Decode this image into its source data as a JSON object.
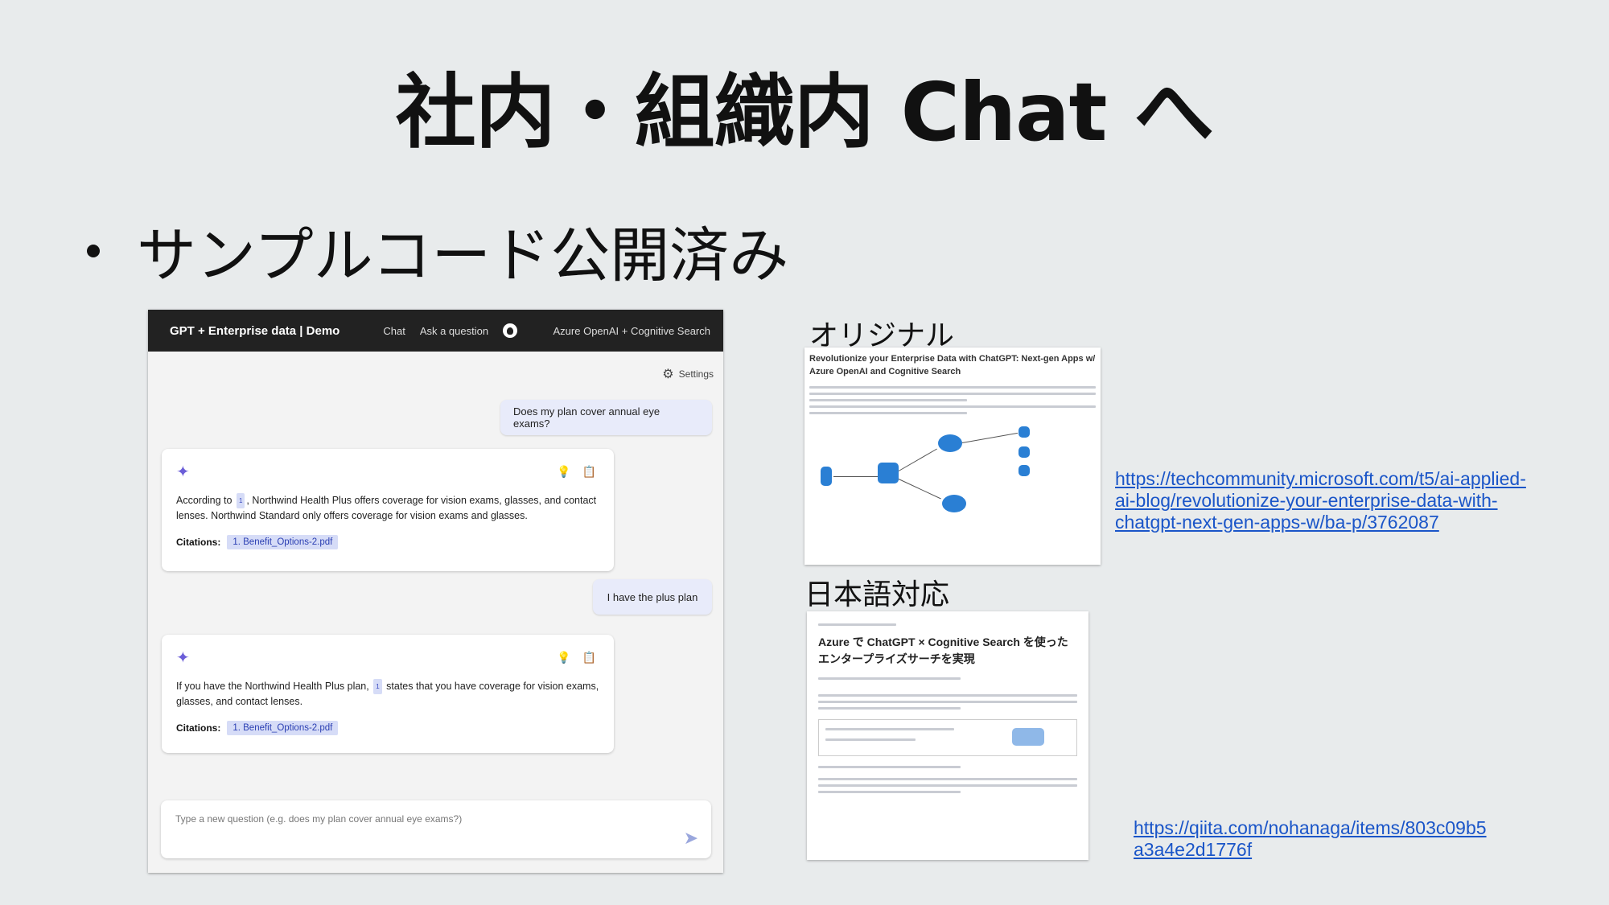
{
  "slide": {
    "title": "社内・組織内 Chat へ",
    "bullet": "サンプルコード公開済み"
  },
  "demo": {
    "brand": "GPT + Enterprise data | Demo",
    "nav": [
      "Chat",
      "Ask a question"
    ],
    "service": "Azure OpenAI + Cognitive Search",
    "settings_label": "Settings",
    "messages": [
      {
        "role": "user",
        "text": "Does my plan cover annual eye exams?"
      },
      {
        "role": "assistant",
        "text_before": "According to",
        "citation_marker": "1",
        "text_after": ", Northwind Health Plus offers coverage for vision exams, glasses, and contact lenses. Northwind Standard only offers coverage for vision exams and glasses.",
        "citations_label": "Citations:",
        "citation": "1. Benefit_Options-2.pdf"
      },
      {
        "role": "user",
        "text": "I have the plus plan"
      },
      {
        "role": "assistant",
        "text_before": "If you have the Northwind Health Plus plan,",
        "citation_marker": "1",
        "text_after": " states that you have coverage for vision exams, glasses, and contact lenses.",
        "citations_label": "Citations:",
        "citation": "1. Benefit_Options-2.pdf"
      }
    ],
    "input_placeholder": "Type a new question (e.g. does my plan cover annual eye exams?)",
    "colors": {
      "header": "#222222",
      "accent": "#6b5ed8",
      "chip": "#d6dcf7"
    }
  },
  "original": {
    "label": "オリジナル",
    "article_title": "Revolutionize your Enterprise Data with ChatGPT: Next-gen Apps w/ Azure OpenAI and Cognitive Search",
    "link": "https://techcommunity.microsoft.com/t5/ai-applied-ai-blog/revolutionize-your-enterprise-data-with-chatgpt-next-gen-apps-w/ba-p/3762087"
  },
  "japanese": {
    "label": "日本語対応",
    "article_title": "Azure で ChatGPT × Cognitive Search を使ったエンタープライズサーチを実現",
    "link": "https://qiita.com/nohanaga/items/803c09b5a3a4e2d1776f"
  }
}
